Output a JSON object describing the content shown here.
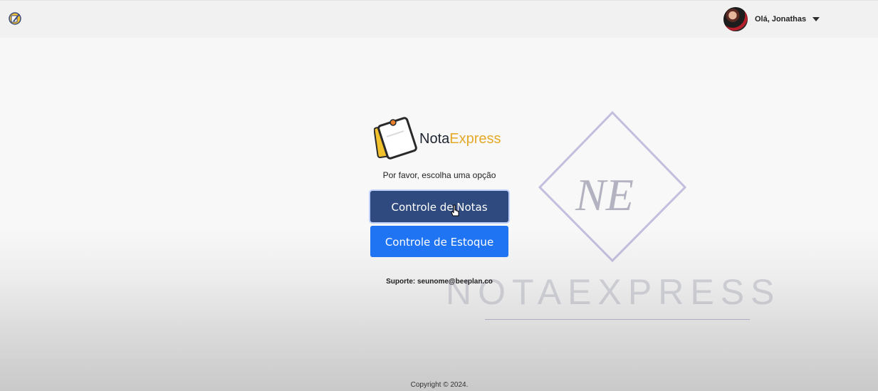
{
  "header": {
    "app_icon": "notepad-pencil-icon",
    "user": {
      "greeting": "Olá, Jonathas",
      "avatar": "user-avatar",
      "menu_icon": "caret-down-icon"
    }
  },
  "logo": {
    "brand_first": "Nota",
    "brand_second": "Express",
    "icon": "sticky-note-icon",
    "colors": {
      "accent": "#e4a927",
      "dark": "#1e2530"
    }
  },
  "main": {
    "prompt": "Por favor, escolha uma opção",
    "buttons": [
      {
        "label": "Controle de Notas",
        "color": "#2f4a7e"
      },
      {
        "label": "Controle de Estoque",
        "color": "#1f74f3"
      }
    ],
    "support": "Suporte: seunome@beeplan.co"
  },
  "watermark": {
    "initials": "NE",
    "word": "NOTAEXPRESS"
  },
  "footer": {
    "copyright": "Copyright © 2024."
  }
}
